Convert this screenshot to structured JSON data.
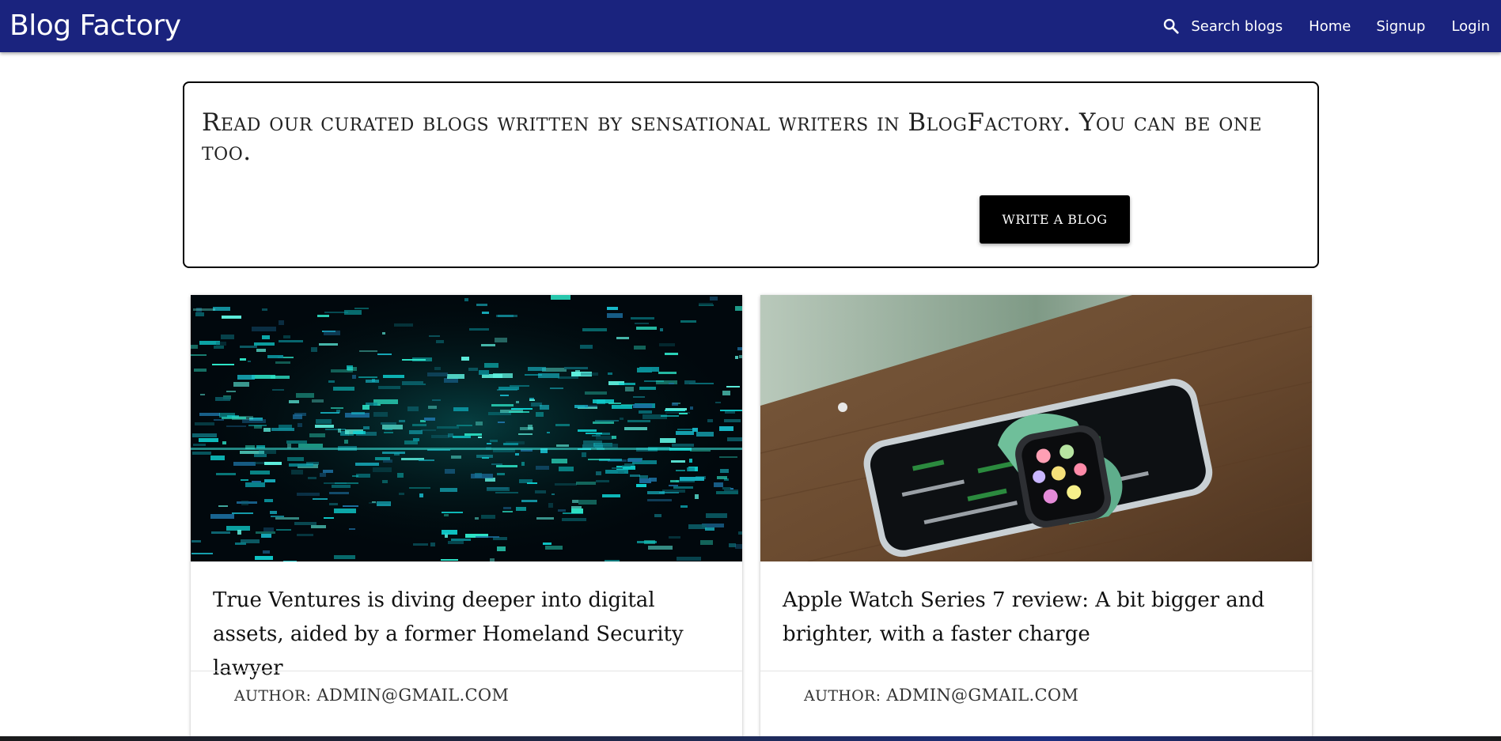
{
  "navbar": {
    "brand": "Blog Factory",
    "search_label": "Search blogs",
    "links": {
      "home": "Home",
      "signup": "Signup",
      "login": "Login"
    },
    "bg_color": "#1a237e"
  },
  "hero": {
    "tagline": "Read our curated blogs written by sensational writers in BlogFactory. You can be one too.",
    "cta_label": "WRITE A BLOG"
  },
  "posts": [
    {
      "image_icon": "digital-glitch-image",
      "title": "True Ventures is diving deeper into digital assets, aided by a former Homeland Security lawyer",
      "author_label": "AUTHOR:",
      "author": "ADMIN@GMAIL.COM"
    },
    {
      "image_icon": "apple-watch-on-phone-image",
      "title": "Apple Watch Series 7 review: A bit bigger and brighter, with a faster charge",
      "author_label": "AUTHOR:",
      "author": "ADMIN@GMAIL.COM"
    }
  ]
}
